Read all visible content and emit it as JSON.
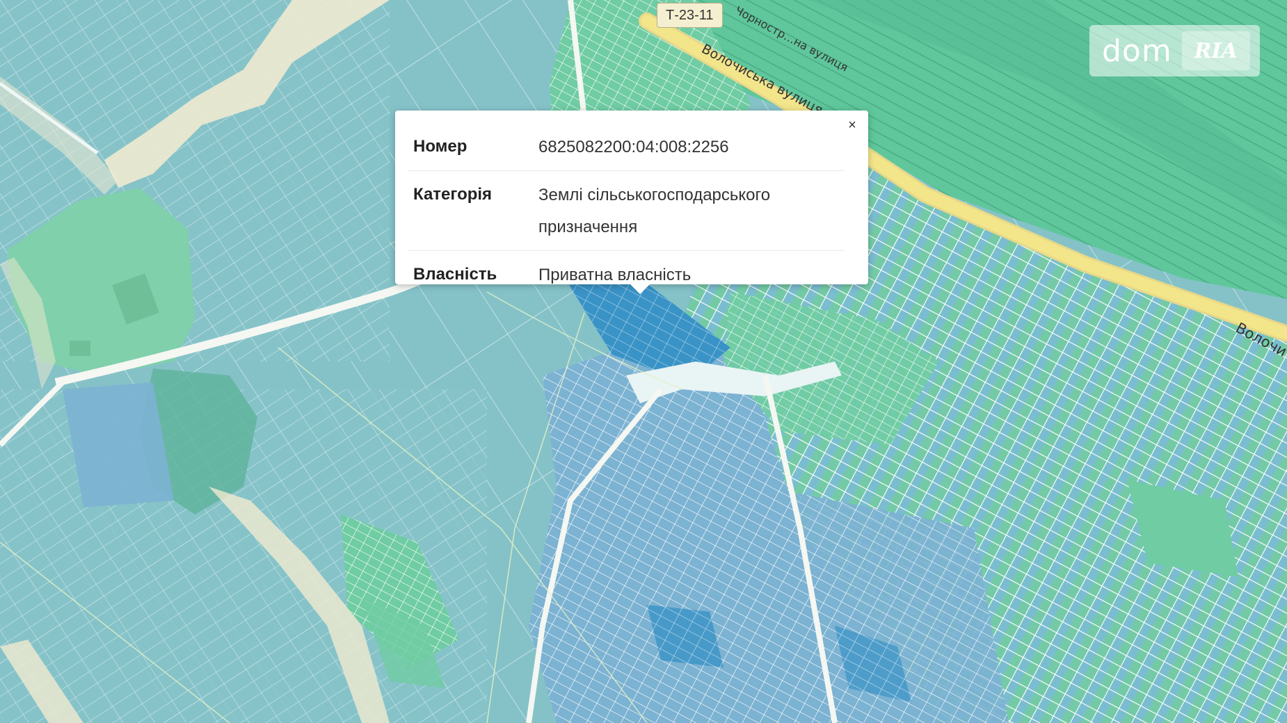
{
  "map": {
    "colors": {
      "parcel_teal": "#83c1c8",
      "parcel_blue": "#7cb2d2",
      "parcel_green": "#6fcca3",
      "parcel_dark_blue": "#3a93c6",
      "road_sand": "#f0ead0",
      "highway_yellow": "#f3e58a",
      "parcel_border": "#e8f3f4"
    },
    "road_badge": "Т-23-11",
    "street_labels": [
      {
        "id": "volochyska-top",
        "text": "Волочиська вулиця"
      },
      {
        "id": "chornovola",
        "text": "Чорностр…на вулиця"
      },
      {
        "id": "volochyska-right",
        "text": "Волочи"
      }
    ]
  },
  "popup": {
    "close_label": "×",
    "rows": [
      {
        "label": "Номер",
        "value": "6825082200:04:008:2256"
      },
      {
        "label": "Категорія",
        "value": "Землі сільськогосподарського призначення"
      },
      {
        "label": "Власність",
        "value": "Приватна власність"
      }
    ]
  },
  "logo": {
    "text": "dom",
    "badge": "RIA"
  }
}
